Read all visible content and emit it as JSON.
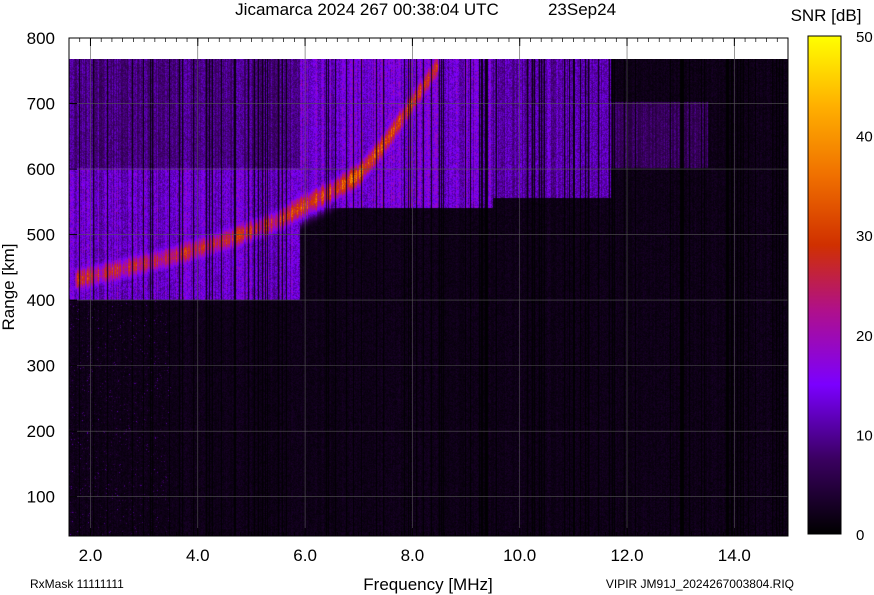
{
  "header": {
    "title": "Jicamarca 2024 267 00:38:04 UTC",
    "date": "23Sep24"
  },
  "footer": {
    "left": "RxMask 11111111",
    "right": "VIPIR  JM91J_2024267003804.RIQ"
  },
  "chart_data": {
    "type": "heatmap",
    "xlabel": "Frequency [MHz]",
    "ylabel": "Range [km]",
    "colorbar_label": "SNR [dB]",
    "xlim": [
      1.6,
      15.0
    ],
    "ylim": [
      40,
      800
    ],
    "data_range_km": [
      40,
      765
    ],
    "clim": [
      0,
      50
    ],
    "xticks": [
      2.0,
      4.0,
      6.0,
      8.0,
      10.0,
      12.0,
      14.0
    ],
    "xtick_labels": [
      "2.0",
      "4.0",
      "6.0",
      "8.0",
      "10.0",
      "12.0",
      "14.0"
    ],
    "yticks": [
      100,
      200,
      300,
      400,
      500,
      600,
      700,
      800
    ],
    "ytick_labels": [
      "100",
      "200",
      "300",
      "400",
      "500",
      "600",
      "700",
      "800"
    ],
    "cticks": [
      0,
      10,
      20,
      30,
      40,
      50
    ],
    "ctick_labels": [
      "0",
      "10",
      "20",
      "30",
      "40",
      "50"
    ],
    "grid": true,
    "colormap": [
      "#000000",
      "#3a0060",
      "#7b00ff",
      "#b0108a",
      "#d03000",
      "#f07000",
      "#ffb000",
      "#ffff00"
    ],
    "echo_trace": {
      "frequency_mhz": [
        1.7,
        2.5,
        3.5,
        4.5,
        5.0,
        5.5,
        5.9,
        6.5,
        7.0,
        7.5,
        8.0,
        8.5
      ],
      "virtual_height_km": [
        430,
        445,
        465,
        490,
        505,
        520,
        540,
        565,
        590,
        640,
        700,
        760
      ],
      "snr_db": [
        27,
        26,
        25,
        26,
        27,
        28,
        30,
        32,
        33,
        30,
        28,
        25
      ]
    },
    "diffuse_regions": [
      {
        "freq": [
          1.6,
          5.9
        ],
        "range_km": [
          400,
          600
        ],
        "snr_db": 13
      },
      {
        "freq": [
          1.6,
          5.9
        ],
        "range_km": [
          600,
          765
        ],
        "snr_db": 9
      },
      {
        "freq": [
          5.9,
          9.5
        ],
        "range_km": [
          540,
          765
        ],
        "snr_db": 14
      },
      {
        "freq": [
          9.5,
          11.7
        ],
        "range_km": [
          555,
          765
        ],
        "snr_db": 11
      },
      {
        "freq": [
          11.7,
          13.5
        ],
        "range_km": [
          600,
          700
        ],
        "snr_db": 7
      }
    ],
    "background_snr_db": 2
  }
}
